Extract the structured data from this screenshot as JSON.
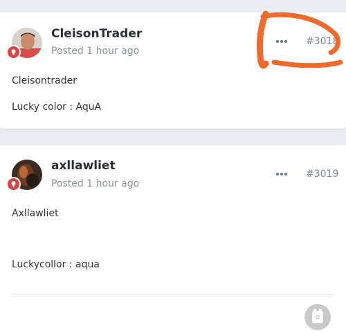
{
  "posts": [
    {
      "author": "CleisonTrader",
      "posted_label": "Posted",
      "time_ago": "1 hour ago",
      "post_number": "#3018",
      "lines": [
        "Cleisontrader",
        "Lucky color : AquA"
      ]
    },
    {
      "author": "axllawliet",
      "posted_label": "Posted",
      "time_ago": "1 hour ago",
      "post_number": "#3019",
      "lines": [
        "Axllawliet",
        "Luckycollor : aqua"
      ]
    }
  ],
  "icons": {
    "more": "more-horizontal-icon",
    "badge": "lightbulb-badge-icon",
    "fab": "bucket-icon"
  },
  "colors": {
    "background": "#e9ecf1",
    "badge": "#d94545",
    "annotation": "#f06a2c"
  }
}
